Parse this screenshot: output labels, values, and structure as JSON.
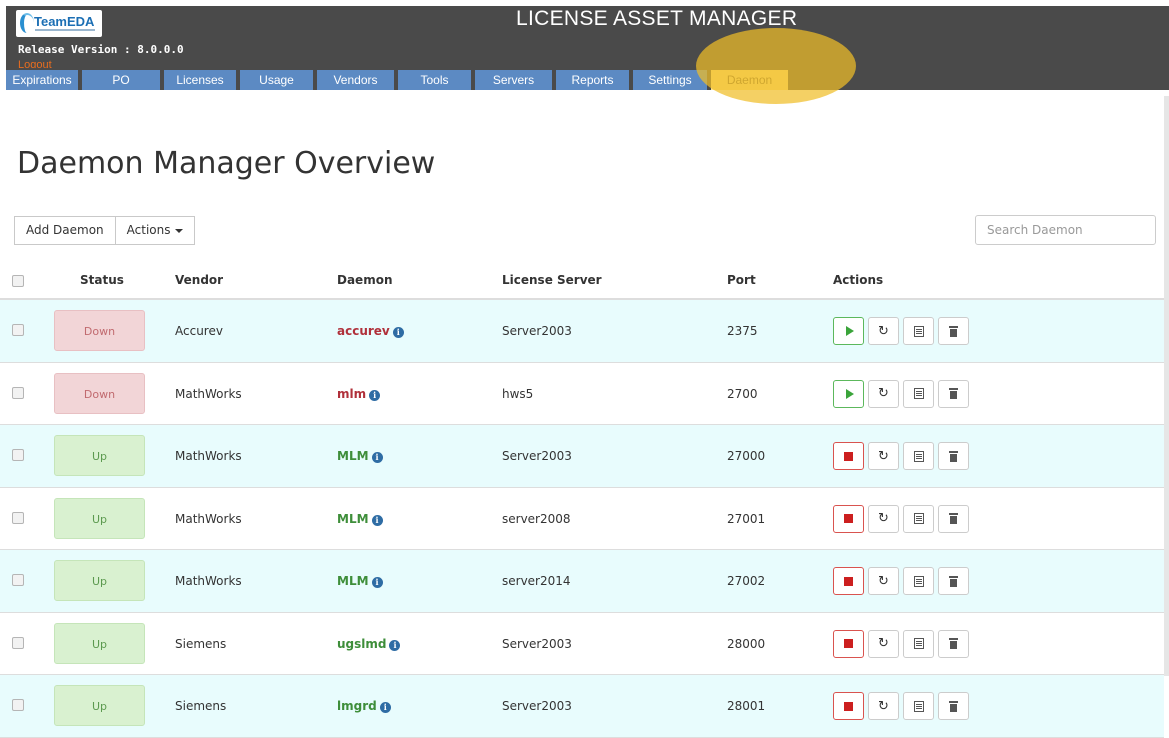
{
  "header": {
    "logo_text": "TeamEDA",
    "release_label": "Release Version : 8.0.0.0",
    "logout_label": "Logout",
    "app_title": "LICENSE ASSET MANAGER"
  },
  "nav": {
    "tabs": [
      {
        "label": "Expirations"
      },
      {
        "label": "PO"
      },
      {
        "label": "Licenses"
      },
      {
        "label": "Usage"
      },
      {
        "label": "Vendors"
      },
      {
        "label": "Tools"
      },
      {
        "label": "Servers"
      },
      {
        "label": "Reports"
      },
      {
        "label": "Settings"
      },
      {
        "label": "Daemon",
        "active": true
      }
    ]
  },
  "main": {
    "title": "Daemon Manager Overview",
    "add_button_label": "Add Daemon",
    "actions_button_label": "Actions",
    "search_placeholder": "Search Daemon"
  },
  "table": {
    "columns": {
      "status": "Status",
      "vendor": "Vendor",
      "daemon": "Daemon",
      "license_server": "License Server",
      "port": "Port",
      "actions": "Actions"
    },
    "rows": [
      {
        "status": "Down",
        "vendor": "Accurev",
        "daemon": "accurev",
        "server": "Server2003",
        "port": "2375"
      },
      {
        "status": "Down",
        "vendor": "MathWorks",
        "daemon": "mlm",
        "server": "hws5",
        "port": "2700"
      },
      {
        "status": "Up",
        "vendor": "MathWorks",
        "daemon": "MLM",
        "server": "Server2003",
        "port": "27000"
      },
      {
        "status": "Up",
        "vendor": "MathWorks",
        "daemon": "MLM",
        "server": "server2008",
        "port": "27001"
      },
      {
        "status": "Up",
        "vendor": "MathWorks",
        "daemon": "MLM",
        "server": "server2014",
        "port": "27002"
      },
      {
        "status": "Up",
        "vendor": "Siemens",
        "daemon": "ugslmd",
        "server": "Server2003",
        "port": "28000"
      },
      {
        "status": "Up",
        "vendor": "Siemens",
        "daemon": "lmgrd",
        "server": "Server2003",
        "port": "28001"
      }
    ]
  },
  "icons": {
    "info": "info-icon",
    "start": "play-icon",
    "stop": "stop-icon",
    "restart": "refresh-icon",
    "log": "document-icon",
    "delete": "trash-icon"
  },
  "colors": {
    "nav_tab": "#5c8ac3",
    "nav_active": "#ffe590",
    "status_down_bg": "#f2d5d7",
    "status_up_bg": "#d9f1d0",
    "daemon_down": "#b0303a",
    "daemon_up": "#3e8e3a"
  }
}
